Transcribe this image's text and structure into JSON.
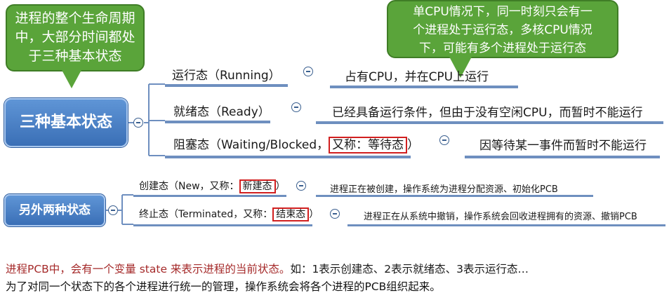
{
  "bubbles": {
    "left": [
      "进程的整个生命周期",
      "中，大部分时间都处",
      "于三种基本状态"
    ],
    "right": [
      "单CPU情况下，同一时刻只会有一",
      "个进程处于运行态，多核CPU情况",
      "下，可能有多个进程处于运行态"
    ]
  },
  "main_root": {
    "label": "三种基本状态"
  },
  "basic_states": [
    {
      "label": "运行态（Running）",
      "desc": "占有CPU，并在CPU上运行"
    },
    {
      "label": "就绪态（Ready）",
      "desc": "已经具备运行条件，但由于没有空闲CPU，而暂时不能运行"
    },
    {
      "label_prefix": "阻塞态（Waiting/Blocked，",
      "alias": "又称：等待态",
      "label_suffix": "）",
      "desc": "因等待某一事件而暂时不能运行"
    }
  ],
  "other_root": {
    "label": "另外两种状态"
  },
  "other_states": [
    {
      "label_prefix": "创建态（New，又称：",
      "alias": "新建态",
      "label_suffix": "）",
      "desc": "进程正在被创建，操作系统为进程分配资源、初始化PCB"
    },
    {
      "label_prefix": "终止态（Terminated，又称：",
      "alias": "结束态",
      "label_suffix": "）",
      "desc": "进程正在从系统中撤销，操作系统会回收进程拥有的资源、撤销PCB"
    }
  ],
  "footer": {
    "line1_red": "进程PCB中，会有一个变量 state 来表示进程的当前状态。",
    "line1_black": "如：1表示创建态、2表示就绪态、3表示运行态…",
    "line2": "为了对同一个状态下的各个进程进行统一的管理，操作系统会将各个进程的PCB组织起来。"
  },
  "colors": {
    "bubble": "#5aa43a",
    "root": "#4a80c6",
    "connector": "#6e8fbf",
    "highlight_box": "#d11f1f",
    "footer_red": "#a52a2a"
  }
}
